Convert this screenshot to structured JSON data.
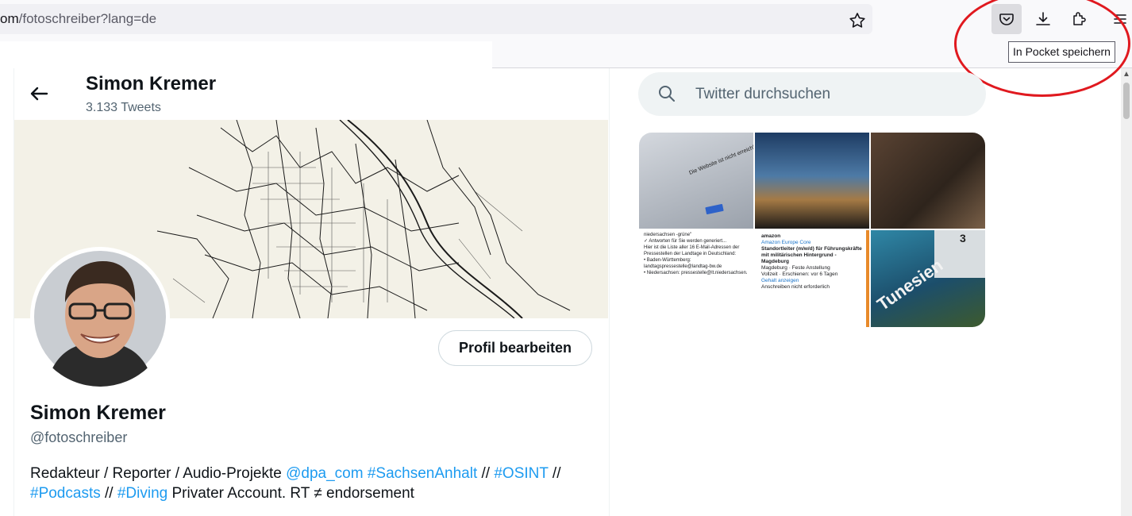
{
  "browser": {
    "url_prefix": "om",
    "url_path": "/fotoschreiber?lang=de",
    "tooltip": "In Pocket speichern",
    "icons": [
      "star-icon",
      "pocket-icon",
      "download-icon",
      "extensions-icon",
      "menu-icon"
    ],
    "annotation_color": "#e0191f"
  },
  "header": {
    "name": "Simon Kremer",
    "tweet_count": "3.133 Tweets"
  },
  "profile": {
    "display_name": "Simon Kremer",
    "handle": "@fotoschreiber",
    "edit_button": "Profil bearbeiten",
    "bio": {
      "text1": "Redakteur / Reporter / Audio-Projekte ",
      "mention": "@dpa_com",
      "sep1": " ",
      "tag1": "#SachsenAnhalt",
      "sep2": " // ",
      "tag2": "#OSINT",
      "sep3": " // ",
      "tag3": "#Podcasts",
      "sep4": " // ",
      "tag4": "#Diving",
      "text2": " Privater Account. RT ≠ endorsement"
    },
    "link_color": "#1d9bf0"
  },
  "sidebar": {
    "search_placeholder": "Twitter durchsuchen",
    "media": {
      "tile1_text": "Die Website ist nicht erreichbar",
      "tile4_lines": [
        "niedersachsen -grüne\"",
        "✓ Antworten für Sie werden generiert...",
        "Hier ist die Liste aller 16 E-Mail-Adressen der Pressestellen der Landtage in Deutschland:",
        "• Baden-Württemberg: landtagspressestelle@landtag-bw.de",
        "• Niedersachsen: pressestelle@lt.niedersachsen."
      ],
      "tile5_lines": [
        "amazon",
        "Amazon Europe Core",
        "Standortleiter (m/w/d) für Führungskräfte mit militärischen Hintergrund - Magdeburg",
        "Magdeburg · Feste Anstellung",
        "Vollzeit · Erschienen: vor 6 Tagen",
        "Gehalt anzeigen",
        "Anschreiben nicht erforderlich"
      ],
      "tile6_title": "Tunesien",
      "tile6_num": "3"
    }
  }
}
